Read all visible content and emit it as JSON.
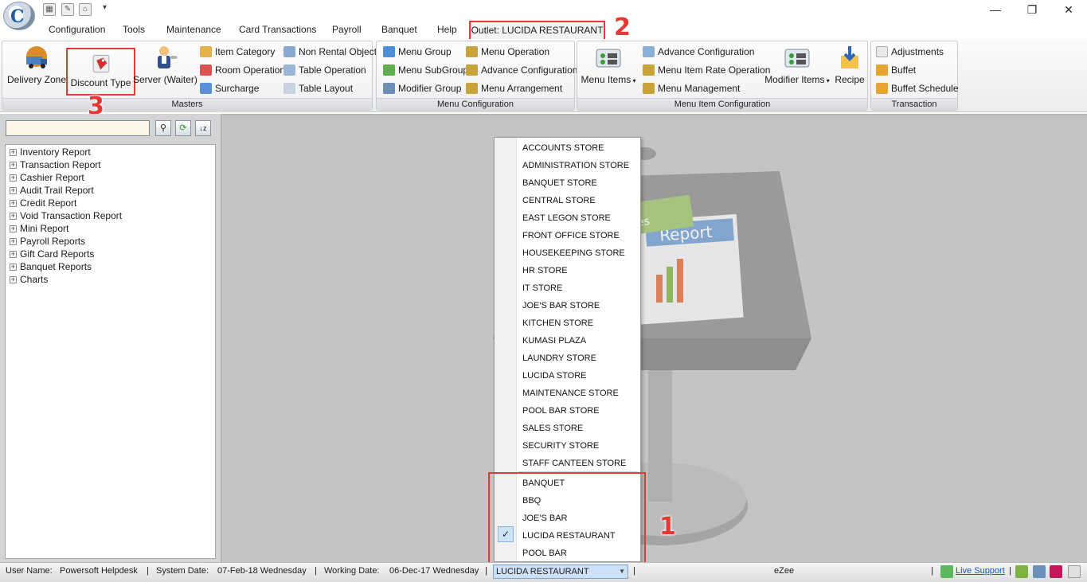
{
  "menu": {
    "tabs": [
      "Configuration",
      "Tools",
      "Maintenance",
      "Card Transactions",
      "Payroll",
      "Banquet",
      "Help"
    ],
    "outlet_tab": "Outlet: LUCIDA RESTAURANT"
  },
  "ribbon": {
    "masters": {
      "label": "Masters",
      "delivery_zone": "Delivery Zone",
      "discount_type": "Discount Type",
      "server_waiter": "Server (Waiter)",
      "item_category": "Item Category",
      "room_operation": "Room Operation",
      "surcharge": "Surcharge",
      "non_rental_object": "Non Rental Object",
      "table_operation": "Table Operation",
      "table_layout": "Table Layout"
    },
    "menu_configuration": {
      "label": "Menu Configuration",
      "menu_group": "Menu Group",
      "menu_subgroup": "Menu SubGroup",
      "modifier_group": "Modifier Group",
      "menu_operation": "Menu Operation",
      "advance_configuration": "Advance Configuration",
      "menu_arrangement": "Menu Arrangement"
    },
    "menu_item_configuration": {
      "label": "Menu Item Configuration",
      "menu_items": "Menu Items",
      "advance_configuration": "Advance Configuration",
      "menu_item_rate_operation": "Menu Item Rate Operation",
      "menu_management": "Menu Management",
      "modifier_items": "Modifier Items",
      "recipe": "Recipe"
    },
    "transaction": {
      "label": "Transaction",
      "adjustments": "Adjustments",
      "buffet": "Buffet",
      "buffet_schedule": "Buffet Schedule"
    }
  },
  "search": {
    "value": ""
  },
  "tree": [
    "Inventory Report",
    "Transaction Report",
    "Cashier Report",
    "Audit Trail Report",
    "Credit Report",
    "Void Transaction Report",
    "Mini Report",
    "Payroll Reports",
    "Gift Card Reports",
    "Banquet Reports",
    "Charts"
  ],
  "dropdown": {
    "stores": [
      "ACCOUNTS STORE",
      "ADMINISTRATION STORE",
      "BANQUET STORE",
      "CENTRAL STORE",
      "EAST LEGON STORE",
      "FRONT OFFICE STORE",
      "HOUSEKEEPING STORE",
      "HR STORE",
      "IT STORE",
      "JOE'S BAR STORE",
      "KITCHEN STORE",
      "KUMASI PLAZA",
      "LAUNDRY STORE",
      "LUCIDA STORE",
      "MAINTENANCE STORE",
      "POOL BAR STORE",
      "SALES STORE",
      "SECURITY STORE",
      "STAFF CANTEEN STORE"
    ],
    "outlets": [
      "BANQUET",
      "BBQ",
      "JOE'S BAR",
      "LUCIDA RESTAURANT",
      "POOL BAR"
    ],
    "checked": "LUCIDA RESTAURANT",
    "check_mark": "✓"
  },
  "annotations": {
    "step1": "1",
    "step2": "2",
    "step3": "3"
  },
  "art": {
    "report_word": "Report",
    "tab_word": "es"
  },
  "status": {
    "user_name_label": "User Name:",
    "user_name": "Powersoft Helpdesk",
    "system_date_label": "System Date:",
    "system_date": "07-Feb-18 Wednesday",
    "working_date_label": "Working Date:",
    "working_date": "06-Dec-17 Wednesday",
    "outlet": "LUCIDA RESTAURANT",
    "brand": "eZee",
    "live_support": "Live Support"
  },
  "colors": {
    "annotation_red": "#e53935",
    "selection_blue": "#cfe0f6"
  }
}
